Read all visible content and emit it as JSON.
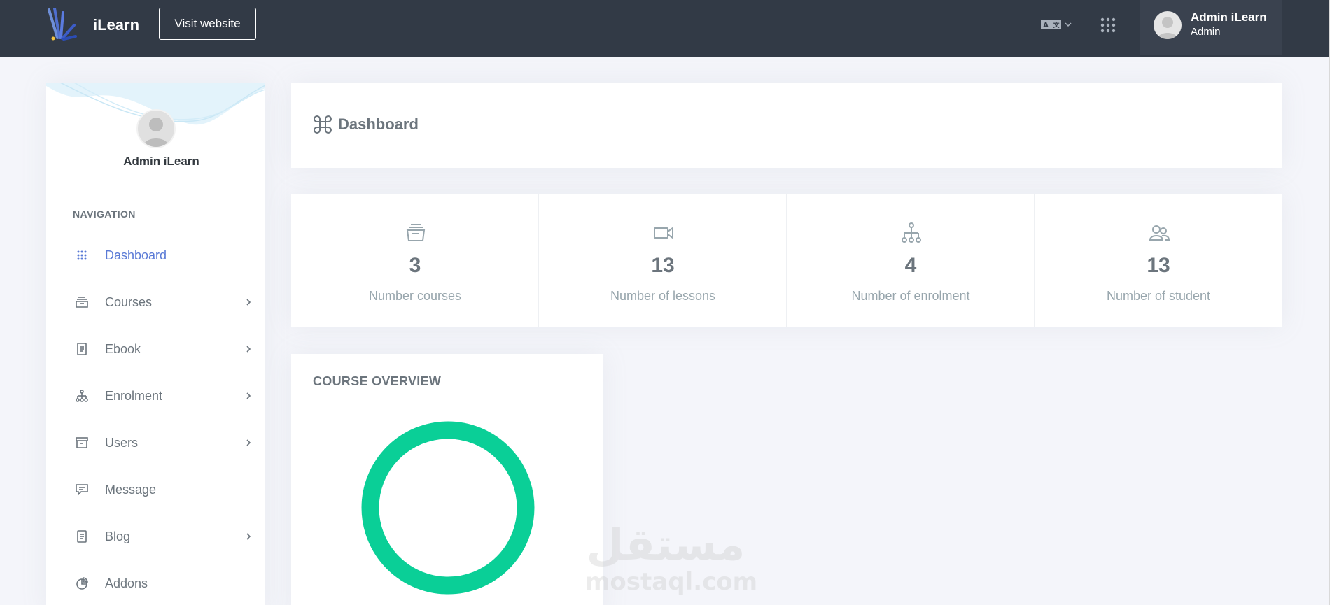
{
  "topbar": {
    "brand": "iLearn",
    "visit_label": "Visit website",
    "lang_icon": "translate-icon",
    "apps_icon": "apps-grid-icon",
    "user": {
      "name": "Admin iLearn",
      "role": "Admin"
    }
  },
  "sidebar": {
    "user_name": "Admin iLearn",
    "nav_title": "NAVIGATION",
    "items": [
      {
        "label": "Dashboard",
        "icon": "dots-grid-icon",
        "active": true,
        "has_children": false
      },
      {
        "label": "Courses",
        "icon": "inbox-icon",
        "active": false,
        "has_children": true
      },
      {
        "label": "Ebook",
        "icon": "document-icon",
        "active": false,
        "has_children": true
      },
      {
        "label": "Enrolment",
        "icon": "hierarchy-icon",
        "active": false,
        "has_children": true
      },
      {
        "label": "Users",
        "icon": "archive-icon",
        "active": false,
        "has_children": true
      },
      {
        "label": "Message",
        "icon": "chat-icon",
        "active": false,
        "has_children": false
      },
      {
        "label": "Blog",
        "icon": "document-icon",
        "active": false,
        "has_children": true
      },
      {
        "label": "Addons",
        "icon": "pie-icon",
        "active": false,
        "has_children": false
      }
    ]
  },
  "header": {
    "title": "Dashboard",
    "icon": "command-icon"
  },
  "stats": [
    {
      "value": "3",
      "label": "Number courses",
      "icon": "inbox-icon"
    },
    {
      "value": "13",
      "label": "Number of lessons",
      "icon": "video-icon"
    },
    {
      "value": "4",
      "label": "Number of enrolment",
      "icon": "hierarchy-icon"
    },
    {
      "value": "13",
      "label": "Number of student",
      "icon": "users-icon"
    }
  ],
  "overview": {
    "title": "COURSE OVERVIEW",
    "ring_color": "#0acf97"
  },
  "watermark": {
    "arabic": "مستقل",
    "latin": "mostaql.com"
  },
  "colors": {
    "topbar": "#323a46",
    "accent": "#5a7ad6",
    "ring": "#0acf97"
  }
}
